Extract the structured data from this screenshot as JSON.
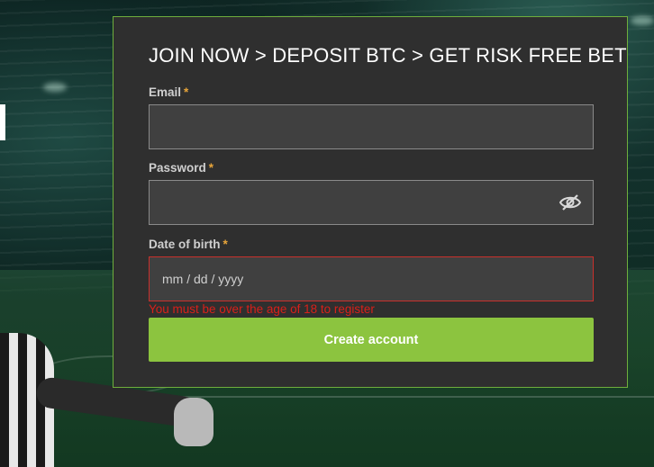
{
  "form": {
    "title": "JOIN NOW > DEPOSIT BTC > GET RISK FREE BET",
    "required_marker": "*",
    "email": {
      "label": "Email",
      "value": "",
      "placeholder": ""
    },
    "password": {
      "label": "Password",
      "value": "",
      "placeholder": "",
      "toggle_icon": "eye-slash-icon"
    },
    "dob": {
      "label": "Date of birth",
      "value": "",
      "placeholder": "mm / dd / yyyy",
      "error": "You must be over the age of 18 to register"
    },
    "submit_label": "Create account"
  },
  "colors": {
    "panel_bg": "#2f2f2f",
    "panel_border": "#6fae3c",
    "field_bg": "#404040",
    "required": "#e8a53a",
    "error": "#d8201a",
    "button": "#8cc43f"
  }
}
